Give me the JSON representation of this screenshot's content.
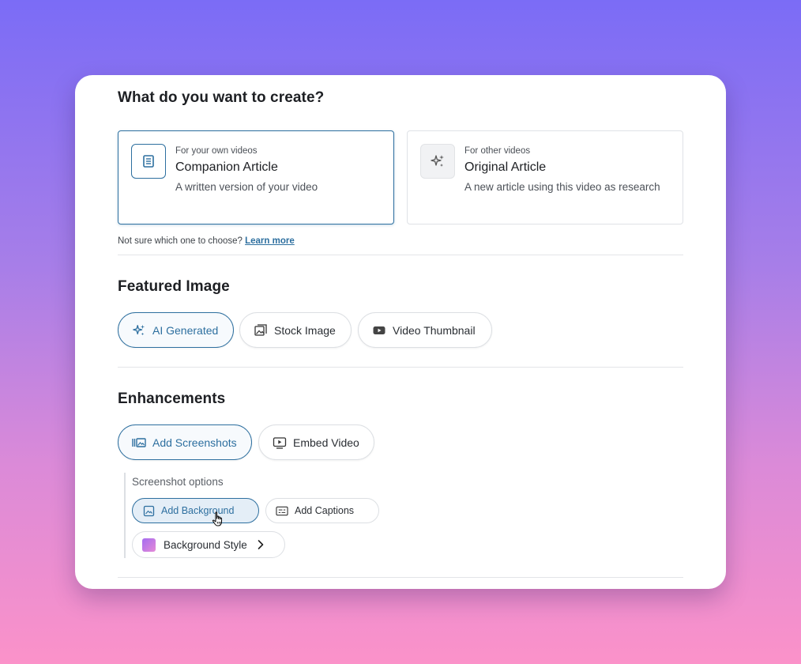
{
  "create_section": {
    "title": "What do you want to create?",
    "options": [
      {
        "kicker": "For your own videos",
        "name": "Companion Article",
        "desc": "A written version of your video",
        "icon": "document-icon",
        "selected": true
      },
      {
        "kicker": "For other videos",
        "name": "Original Article",
        "desc": "A new article using this video as research",
        "icon": "sparkle-icon",
        "selected": false
      }
    ],
    "hint_text": "Not sure which one to choose?",
    "hint_link": "Learn more"
  },
  "featured_image": {
    "title": "Featured Image",
    "options": [
      {
        "label": "AI Generated",
        "icon": "sparkles-icon",
        "active": true
      },
      {
        "label": "Stock Image",
        "icon": "image-stack-icon",
        "active": false
      },
      {
        "label": "Video Thumbnail",
        "icon": "play-rect-icon",
        "active": false
      }
    ]
  },
  "enhancements": {
    "title": "Enhancements",
    "options": [
      {
        "label": "Add Screenshots",
        "icon": "screenshots-icon",
        "active": true
      },
      {
        "label": "Embed Video",
        "icon": "embed-video-icon",
        "active": false
      }
    ],
    "screenshot_options": {
      "label": "Screenshot options",
      "chips": [
        {
          "label": "Add Background",
          "icon": "background-image-icon",
          "active": true
        },
        {
          "label": "Add Captions",
          "icon": "captions-icon",
          "active": false
        }
      ],
      "style_chip": {
        "label": "Background Style",
        "swatch": "gradient-swatch"
      }
    }
  },
  "colors": {
    "accent": "#2d6f9f",
    "background_top": "#7b6cf6",
    "background_bottom": "#fb92c9"
  }
}
